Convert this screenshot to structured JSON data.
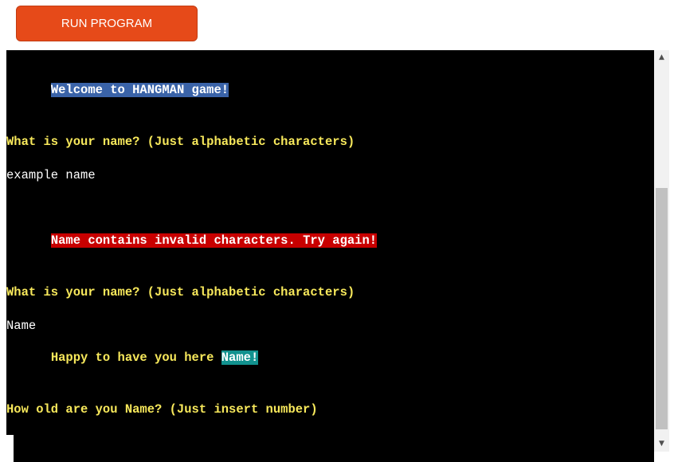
{
  "toolbar": {
    "run_label": "RUN PROGRAM"
  },
  "terminal": {
    "welcome": "Welcome to HANGMAN game!",
    "prompt_name_1": "What is your name? (Just alphabetic characters)",
    "input_1": "example name",
    "error": "Name contains invalid characters. Try again!",
    "prompt_name_2": "What is your name? (Just alphabetic characters)",
    "input_2": "Name",
    "greeting_prefix": "Happy to have you here ",
    "greeting_name": "Name!",
    "prompt_age": "How old are you Name? (Just insert number)"
  },
  "scrollbar": {
    "up_icon": "scroll-up-arrow-icon",
    "down_icon": "scroll-down-arrow-icon"
  },
  "colors": {
    "button": "#e64a19",
    "terminal_bg": "#000000",
    "prompt_text": "#f7e85b",
    "welcome_highlight": "#3a63a8",
    "error_highlight": "#c80000",
    "name_highlight": "#12928f"
  }
}
